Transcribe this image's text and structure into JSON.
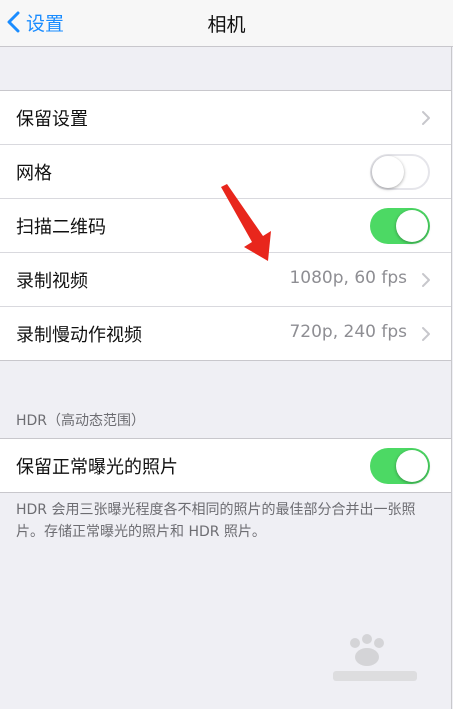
{
  "nav": {
    "back_label": "设置",
    "title": "相机"
  },
  "group1": {
    "rows": [
      {
        "label": "保留设置"
      },
      {
        "label": "网格",
        "toggle": "off"
      },
      {
        "label": "扫描二维码",
        "toggle": "on"
      },
      {
        "label": "录制视频",
        "value": "1080p, 60 fps"
      },
      {
        "label": "录制慢动作视频",
        "value": "720p, 240 fps"
      }
    ]
  },
  "hdr": {
    "header": "HDR（高动态范围）",
    "row_label": "保留正常曝光的照片",
    "toggle": "on",
    "footer": "HDR 会用三张曝光程度各不相同的照片的最佳部分合并出一张照片。存储正常曝光的照片和 HDR 照片。"
  },
  "colors": {
    "accent": "#1a8cff",
    "toggle_on": "#4cd964",
    "arrow": "#e8261c",
    "background": "#efeff4"
  },
  "icons": [
    "chevron-left-icon",
    "chevron-right-icon",
    "red-arrow-annotation",
    "baidu-jingyan-watermark"
  ]
}
